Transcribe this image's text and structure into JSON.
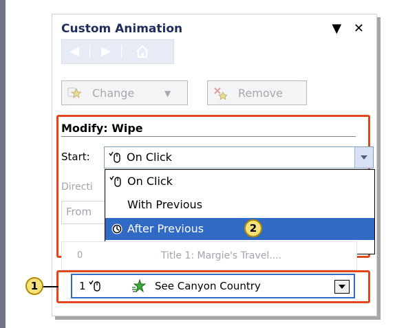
{
  "pane": {
    "title": "Custom Animation",
    "dropdown_glyph": "▼",
    "close_glyph": "✕"
  },
  "toolbar": {
    "change_label": "Change",
    "remove_label": "Remove"
  },
  "modify": {
    "title": "Modify: Wipe",
    "start_label": "Start:",
    "start_value": "On Click",
    "direction_label": "Directi",
    "direction_value": "From",
    "options": [
      "On Click",
      "With Previous",
      "After Previous"
    ],
    "selected_option": "After Previous"
  },
  "list": {
    "ghost_number": "0",
    "ghost_text": "Title 1: Margie's Travel....",
    "item_number": "1",
    "item_text": "See Canyon Country"
  },
  "callouts": {
    "one": "1",
    "two": "2"
  },
  "colors": {
    "highlight": "#e2461c",
    "selection": "#316ac5",
    "callout_fill": "#f5e27a"
  }
}
